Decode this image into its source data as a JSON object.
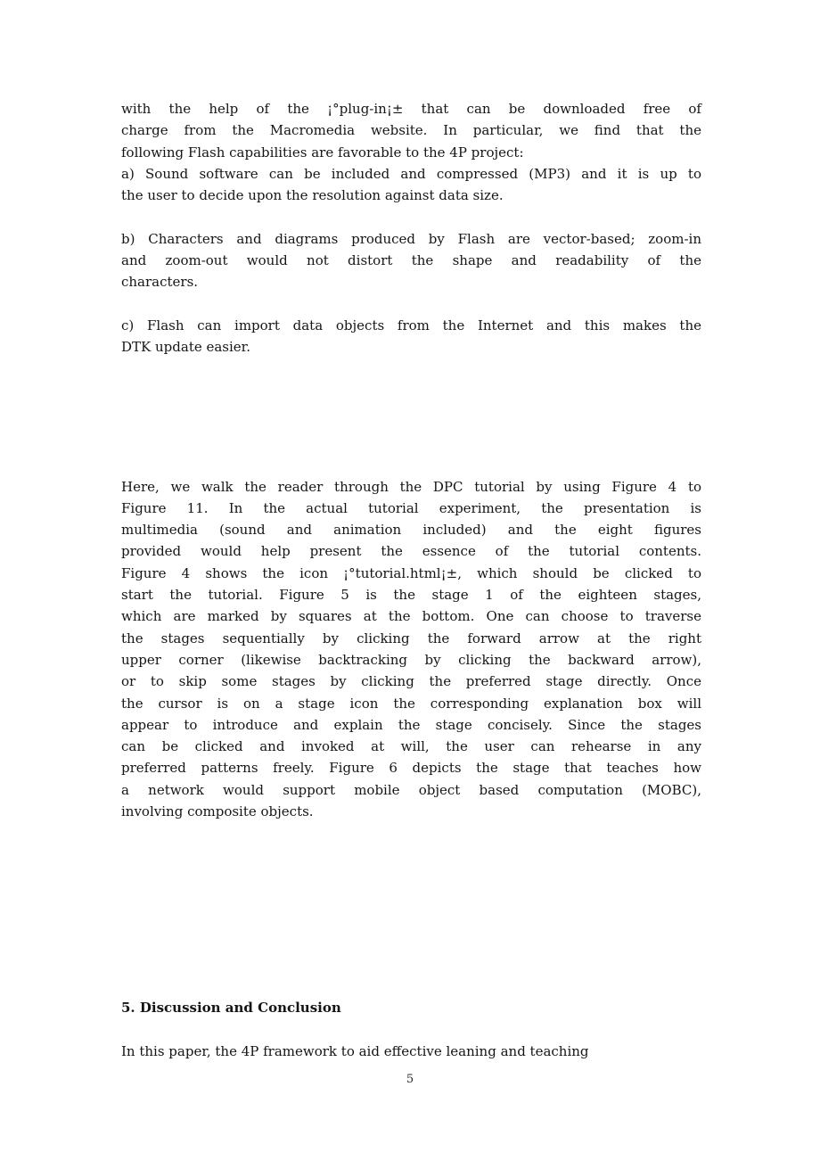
{
  "page": {
    "number": "5",
    "background_color": "#ffffff",
    "text_color": "#151515"
  },
  "body": {
    "paragraph_continued": {
      "lines": [
        "with the help of the ¡°plug-in¡± that can be downloaded free of",
        "charge from the Macromedia website. In particular, we find that the",
        "following Flash capabilities are favorable to the 4P project:"
      ]
    },
    "item_a": {
      "lines": [
        "a) Sound software can be included and compressed (MP3) and it is up to",
        "the user to decide upon the resolution against data size."
      ]
    },
    "item_b": {
      "lines": [
        "b) Characters and diagrams produced by Flash are vector-based; zoom-in",
        "and zoom-out would not distort the shape and readability of the",
        "characters."
      ]
    },
    "item_c": {
      "lines": [
        "c) Flash can import data objects from the Internet and this makes the",
        "DTK update easier."
      ]
    },
    "tutorial_paragraph": {
      "lines": [
        "Here, we walk the reader through the DPC tutorial by using Figure 4 to",
        "Figure 11. In the actual tutorial experiment, the presentation is",
        "multimedia (sound and animation included) and the eight figures",
        "provided would help present the essence of the tutorial contents.",
        "Figure 4 shows the icon ¡°tutorial.html¡±, which should be clicked to",
        "start the tutorial. Figure 5 is the stage 1 of the eighteen stages,",
        "which are marked by squares at the bottom. One can choose to traverse",
        "the stages sequentially by clicking the forward arrow at the right",
        "upper corner (likewise backtracking by clicking the backward arrow),",
        "or to skip some stages by clicking the preferred stage directly. Once",
        "the cursor is on a stage icon the corresponding explanation box will",
        "appear to introduce and explain the stage concisely. Since the stages",
        "can be clicked and invoked at will, the user can rehearse in any",
        "preferred patterns freely. Figure 6 depicts the stage that teaches how",
        "a network would support mobile object based computation (MOBC),",
        "involving composite objects."
      ]
    },
    "section_heading": "5. Discussion and Conclusion",
    "conclusion_paragraph": {
      "lines": [
        "In this paper, the 4P framework to aid effective leaning and teaching"
      ]
    }
  }
}
